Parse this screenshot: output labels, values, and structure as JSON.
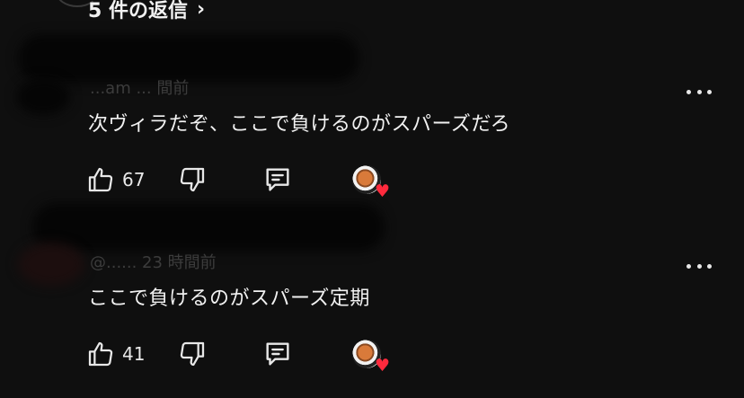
{
  "replies": {
    "label": "5 件の返信",
    "chevron": "›"
  },
  "comments": [
    {
      "meta_faint": "...am ... 間前",
      "text": "次ヴィラだぞ、ここで負けるのがスパーズだろ",
      "likes": "67",
      "icons": [
        "thumbs-up-icon",
        "thumbs-down-icon",
        "reply-icon",
        "creator-heart-icon"
      ]
    },
    {
      "meta_faint": "@...... 23 時間前",
      "text": "ここで負けるのがスパーズ定期",
      "likes": "41",
      "icons": [
        "thumbs-up-icon",
        "thumbs-down-icon",
        "reply-icon",
        "creator-heart-icon"
      ]
    }
  ],
  "colors": {
    "background": "#0f0f0f",
    "text": "#f1f1f1",
    "heart": "#ff2a3d"
  }
}
